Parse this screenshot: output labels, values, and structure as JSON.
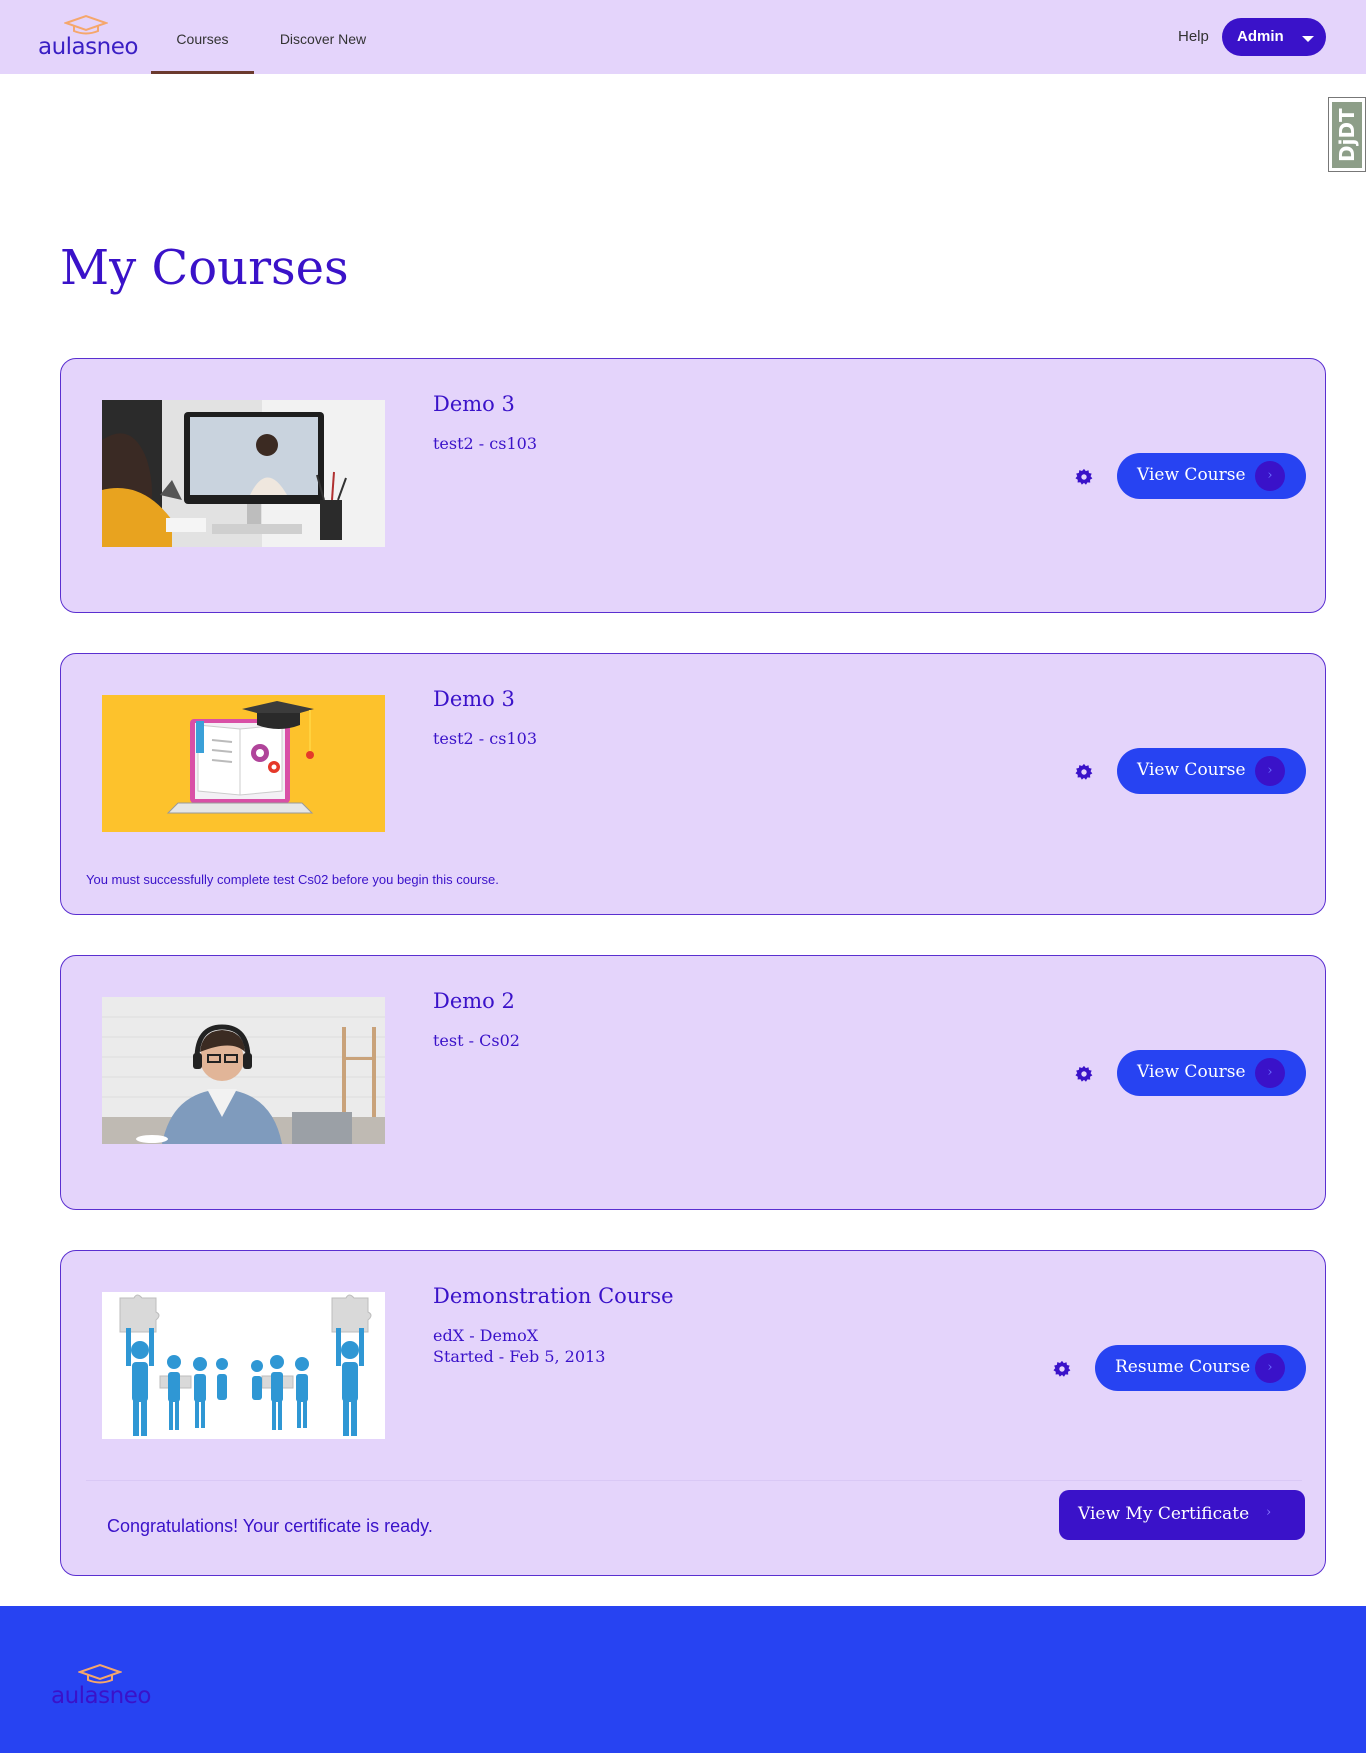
{
  "header": {
    "logo_text": "aulasneo",
    "tabs": [
      {
        "label": "Courses",
        "active": true
      },
      {
        "label": "Discover New",
        "active": false
      }
    ],
    "help_label": "Help",
    "user_label": "Admin"
  },
  "debug_toolbar": {
    "label": "DjDT"
  },
  "page_title": "My Courses",
  "courses": [
    {
      "title": "Demo 3",
      "subtitle": "test2 - cs103",
      "button_label": "View Course",
      "image": "woman-video-call-photo"
    },
    {
      "title": "Demo 3",
      "subtitle": "test2 - cs103",
      "button_label": "View Course",
      "image": "laptop-book-graduation-cap-illustration",
      "note": "You must successfully complete test Cs02 before you begin this course."
    },
    {
      "title": "Demo 2",
      "subtitle": "test - Cs02",
      "button_label": "View Course",
      "image": "man-with-headphones-photo"
    },
    {
      "title": "Demonstration Course",
      "subtitle": "edX - DemoX",
      "started": "Started - Feb 5, 2013",
      "button_label": "Resume Course",
      "image": "puzzle-people-teamwork-illustration",
      "certificate_message": "Congratulations! Your certificate is ready.",
      "certificate_button_label": "View My Certificate"
    }
  ],
  "footer": {
    "logo_text": "aulasneo"
  },
  "colors": {
    "header_bg": "#e4d4fb",
    "primary": "#3a12c9",
    "button_blue": "#2743f2",
    "card_bg": "#e4d4fb",
    "logo_cap": "#f5a76c"
  }
}
